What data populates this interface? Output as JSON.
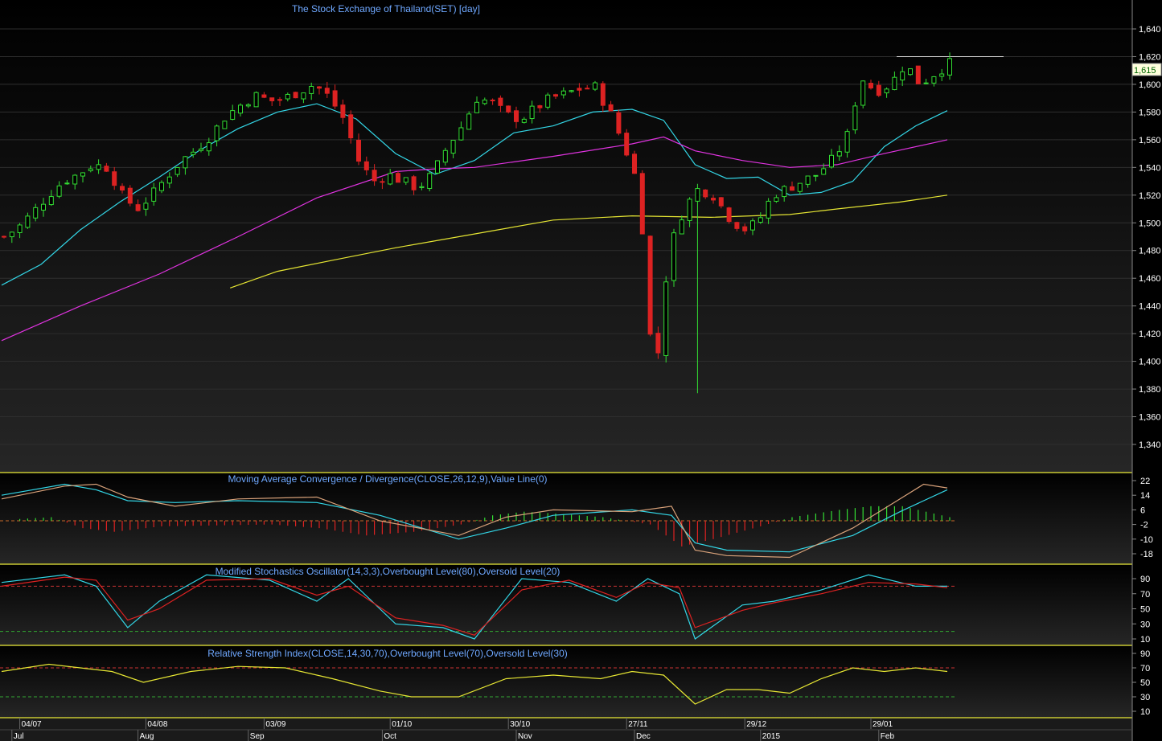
{
  "window": {
    "title": "The Stock Exchange of Thailand(SET) [day]"
  },
  "colors": {
    "background": "#000000",
    "panel_border": "#c8c832",
    "up_candle": "#33dd33",
    "down_candle": "#dd2222",
    "ma_short": "#33d6e6",
    "ma_mid": "#e033e0",
    "ma_long": "#e6e633",
    "macd_line": "#33d6e6",
    "macd_signal": "#d9a27a",
    "stoch_k": "#33d6e6",
    "stoch_d": "#dd2222",
    "rsi_line": "#e6e633",
    "overbought": "#cc3333",
    "oversold": "#33aa33",
    "label_text": "#6fa8ff",
    "tick_text": "#ffffff"
  },
  "chart_data": [
    {
      "type": "candlestick",
      "panel": "price",
      "title": "The Stock Exchange of Thailand(SET) [day]",
      "ylim": [
        1330,
        1650
      ],
      "y_ticks": [
        "1,640",
        "1,620",
        "1,600",
        "1,580",
        "1,560",
        "1,540",
        "1,520",
        "1,500",
        "1,480",
        "1,460",
        "1,440",
        "1,420",
        "1,400",
        "1,380",
        "1,360",
        "1,340"
      ],
      "last_price_label": "1,615",
      "resistance_level": 1620,
      "grid": true,
      "series": [
        {
          "kind": "close_path",
          "values": [
            1490,
            1497,
            1508,
            1520,
            1530,
            1535,
            1542,
            1540,
            1520,
            1510,
            1520,
            1533,
            1545,
            1553,
            1563,
            1577,
            1585,
            1592,
            1588,
            1590,
            1595,
            1600,
            1591,
            1575,
            1545,
            1530,
            1535,
            1530,
            1525,
            1535,
            1555,
            1570,
            1590,
            1587,
            1578,
            1575,
            1583,
            1590,
            1593,
            1597,
            1598,
            1580,
            1555,
            1525,
            1380,
            1480,
            1510,
            1525,
            1520,
            1505,
            1495,
            1500,
            1520,
            1525,
            1530,
            1535,
            1545,
            1560,
            1605,
            1595,
            1600,
            1615,
            1600,
            1608,
            1615
          ]
        },
        {
          "kind": "ma",
          "name": "",
          "color_key": "ma_short",
          "points": [
            [
              0,
              1455
            ],
            [
              5,
              1470
            ],
            [
              10,
              1495
            ],
            [
              15,
              1515
            ],
            [
              20,
              1533
            ],
            [
              25,
              1552
            ],
            [
              30,
              1568
            ],
            [
              35,
              1580
            ],
            [
              40,
              1586
            ],
            [
              45,
              1575
            ],
            [
              50,
              1550
            ],
            [
              55,
              1535
            ],
            [
              60,
              1545
            ],
            [
              65,
              1565
            ],
            [
              70,
              1570
            ],
            [
              75,
              1580
            ],
            [
              80,
              1582
            ],
            [
              84,
              1574
            ],
            [
              88,
              1542
            ],
            [
              92,
              1532
            ],
            [
              96,
              1533
            ],
            [
              100,
              1520
            ],
            [
              104,
              1522
            ],
            [
              108,
              1530
            ],
            [
              112,
              1555
            ],
            [
              116,
              1570
            ],
            [
              120,
              1581
            ]
          ]
        },
        {
          "kind": "ma",
          "name": "",
          "color_key": "ma_mid",
          "points": [
            [
              0,
              1415
            ],
            [
              10,
              1440
            ],
            [
              20,
              1463
            ],
            [
              30,
              1490
            ],
            [
              40,
              1518
            ],
            [
              50,
              1537
            ],
            [
              55,
              1539
            ],
            [
              60,
              1540
            ],
            [
              70,
              1548
            ],
            [
              80,
              1557
            ],
            [
              84,
              1562
            ],
            [
              88,
              1552
            ],
            [
              94,
              1545
            ],
            [
              100,
              1540
            ],
            [
              106,
              1542
            ],
            [
              112,
              1550
            ],
            [
              120,
              1560
            ]
          ]
        },
        {
          "kind": "ma",
          "name": "",
          "color_key": "ma_long",
          "points": [
            [
              29,
              1453
            ],
            [
              35,
              1465
            ],
            [
              42,
              1473
            ],
            [
              50,
              1482
            ],
            [
              60,
              1492
            ],
            [
              70,
              1502
            ],
            [
              80,
              1505
            ],
            [
              90,
              1504
            ],
            [
              100,
              1506
            ],
            [
              106,
              1510
            ],
            [
              114,
              1515
            ],
            [
              120,
              1520
            ]
          ]
        }
      ]
    },
    {
      "type": "line",
      "panel": "macd",
      "title": "Moving Average Convergence / Divergence(CLOSE,26,12,9),Value Line(0)",
      "ylim": [
        -22,
        25
      ],
      "y_ticks": [
        "22",
        "14",
        "6",
        "-2",
        "-10",
        "-18"
      ],
      "series": [
        {
          "name": "",
          "color_key": "macd_line",
          "points": [
            [
              0,
              14
            ],
            [
              8,
              20
            ],
            [
              12,
              17
            ],
            [
              16,
              11
            ],
            [
              22,
              10
            ],
            [
              30,
              11
            ],
            [
              40,
              10
            ],
            [
              48,
              3
            ],
            [
              58,
              -10
            ],
            [
              64,
              -4
            ],
            [
              70,
              3
            ],
            [
              80,
              6
            ],
            [
              85,
              3
            ],
            [
              88,
              -12
            ],
            [
              92,
              -16
            ],
            [
              100,
              -17
            ],
            [
              108,
              -8
            ],
            [
              114,
              5
            ],
            [
              120,
              17
            ]
          ]
        },
        {
          "name": "",
          "color_key": "macd_signal",
          "points": [
            [
              0,
              12
            ],
            [
              8,
              19
            ],
            [
              12,
              20
            ],
            [
              16,
              13
            ],
            [
              22,
              8
            ],
            [
              30,
              12
            ],
            [
              40,
              13
            ],
            [
              48,
              0
            ],
            [
              58,
              -8
            ],
            [
              64,
              2
            ],
            [
              70,
              6
            ],
            [
              80,
              5
            ],
            [
              85,
              8
            ],
            [
              88,
              -16
            ],
            [
              92,
              -19
            ],
            [
              100,
              -20
            ],
            [
              108,
              -4
            ],
            [
              114,
              12
            ],
            [
              117,
              20
            ],
            [
              120,
              18
            ]
          ]
        },
        {
          "name": "",
          "color_key": "down_candle",
          "kind": "histogram",
          "points": [
            [
              2,
              1
            ],
            [
              6,
              2
            ],
            [
              10,
              -4
            ],
            [
              14,
              -6
            ],
            [
              20,
              -3
            ],
            [
              34,
              -2
            ],
            [
              40,
              -4
            ],
            [
              46,
              -8
            ],
            [
              52,
              -6
            ],
            [
              58,
              -2
            ],
            [
              62,
              3
            ],
            [
              66,
              5
            ],
            [
              70,
              4
            ],
            [
              76,
              2
            ],
            [
              82,
              -2
            ],
            [
              86,
              -14
            ],
            [
              90,
              -10
            ],
            [
              96,
              -3
            ],
            [
              100,
              2
            ],
            [
              106,
              6
            ],
            [
              110,
              8
            ],
            [
              114,
              8
            ],
            [
              118,
              4
            ],
            [
              120,
              2
            ]
          ]
        }
      ]
    },
    {
      "type": "line",
      "panel": "stochastic",
      "title": "Modified Stochastics Oscillator(14,3,3),Overbought Level(80),Oversold Level(20)",
      "ylim": [
        0,
        100
      ],
      "y_ticks": [
        "90",
        "70",
        "50",
        "30",
        "10"
      ],
      "overbought": 80,
      "oversold": 20,
      "series": [
        {
          "name": "",
          "color_key": "stoch_k",
          "points": [
            [
              0,
              85
            ],
            [
              8,
              95
            ],
            [
              12,
              80
            ],
            [
              16,
              25
            ],
            [
              20,
              60
            ],
            [
              26,
              95
            ],
            [
              34,
              88
            ],
            [
              40,
              60
            ],
            [
              44,
              90
            ],
            [
              50,
              30
            ],
            [
              56,
              25
            ],
            [
              60,
              10
            ],
            [
              66,
              90
            ],
            [
              72,
              85
            ],
            [
              78,
              60
            ],
            [
              82,
              90
            ],
            [
              86,
              70
            ],
            [
              88,
              10
            ],
            [
              94,
              55
            ],
            [
              98,
              60
            ],
            [
              104,
              75
            ],
            [
              110,
              95
            ],
            [
              116,
              80
            ],
            [
              120,
              80
            ]
          ]
        },
        {
          "name": "",
          "color_key": "stoch_d",
          "points": [
            [
              0,
              80
            ],
            [
              8,
              92
            ],
            [
              12,
              88
            ],
            [
              16,
              35
            ],
            [
              20,
              50
            ],
            [
              26,
              88
            ],
            [
              34,
              90
            ],
            [
              40,
              68
            ],
            [
              44,
              80
            ],
            [
              50,
              38
            ],
            [
              56,
              28
            ],
            [
              60,
              15
            ],
            [
              66,
              75
            ],
            [
              72,
              88
            ],
            [
              78,
              65
            ],
            [
              82,
              85
            ],
            [
              86,
              78
            ],
            [
              88,
              25
            ],
            [
              94,
              48
            ],
            [
              98,
              58
            ],
            [
              104,
              70
            ],
            [
              110,
              85
            ],
            [
              116,
              83
            ],
            [
              120,
              78
            ]
          ]
        }
      ]
    },
    {
      "type": "line",
      "panel": "rsi",
      "title": "Relative Strength Index(CLOSE,14,30,70),Overbought Level(70),Oversold Level(30)",
      "ylim": [
        0,
        100
      ],
      "y_ticks": [
        "90",
        "70",
        "50",
        "30",
        "10"
      ],
      "overbought": 70,
      "oversold": 30,
      "series": [
        {
          "name": "",
          "color_key": "rsi_line",
          "points": [
            [
              0,
              65
            ],
            [
              6,
              75
            ],
            [
              10,
              70
            ],
            [
              14,
              65
            ],
            [
              18,
              50
            ],
            [
              24,
              65
            ],
            [
              30,
              72
            ],
            [
              36,
              70
            ],
            [
              42,
              55
            ],
            [
              48,
              38
            ],
            [
              52,
              30
            ],
            [
              58,
              30
            ],
            [
              64,
              55
            ],
            [
              70,
              60
            ],
            [
              76,
              55
            ],
            [
              80,
              65
            ],
            [
              84,
              60
            ],
            [
              88,
              20
            ],
            [
              92,
              40
            ],
            [
              96,
              40
            ],
            [
              100,
              35
            ],
            [
              104,
              55
            ],
            [
              108,
              70
            ],
            [
              112,
              65
            ],
            [
              116,
              70
            ],
            [
              120,
              65
            ]
          ]
        }
      ]
    }
  ],
  "x_axis": {
    "date_labels": [
      {
        "bar": 2,
        "label": "04/07"
      },
      {
        "bar": 18,
        "label": "04/08"
      },
      {
        "bar": 33,
        "label": "03/09"
      },
      {
        "bar": 49,
        "label": "01/10"
      },
      {
        "bar": 64,
        "label": "30/10"
      },
      {
        "bar": 79,
        "label": "27/11"
      },
      {
        "bar": 94,
        "label": "29/12"
      },
      {
        "bar": 110,
        "label": "29/01"
      }
    ],
    "month_labels": [
      {
        "bar": 1,
        "label": "Jul"
      },
      {
        "bar": 17,
        "label": "Aug"
      },
      {
        "bar": 31,
        "label": "Sep"
      },
      {
        "bar": 48,
        "label": "Oct"
      },
      {
        "bar": 65,
        "label": "Nov"
      },
      {
        "bar": 80,
        "label": "Dec"
      },
      {
        "bar": 96,
        "label": "2015"
      },
      {
        "bar": 111,
        "label": "Feb"
      }
    ]
  }
}
